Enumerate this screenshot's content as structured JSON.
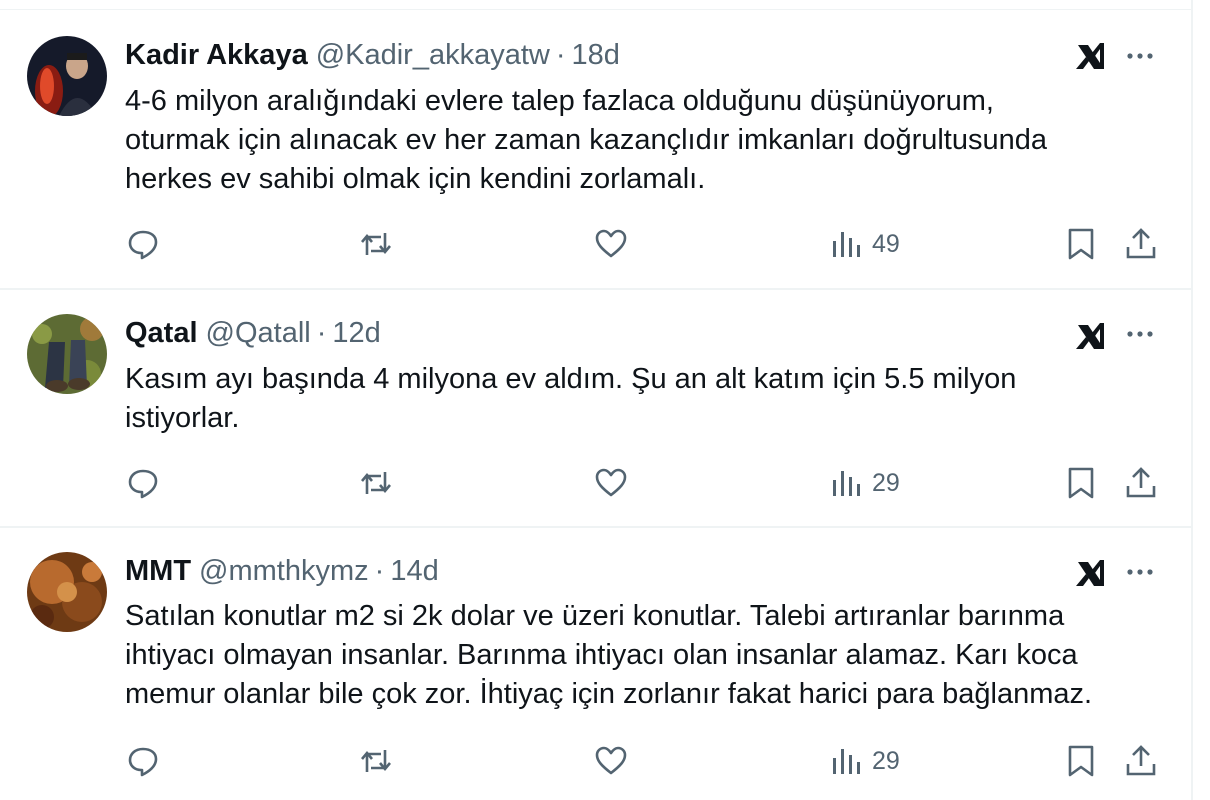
{
  "tweets": [
    {
      "name": "Kadir Akkaya",
      "handle": "@Kadir_akkayatw",
      "separator": "·",
      "time": "18d",
      "text": "4-6 milyon aralığındaki evlere talep fazlaca olduğunu düşünüyorum,\noturmak için alınacak ev her zaman kazançlıdır imkanları doğrultusunda\nherkes ev sahibi olmak için kendini zorlamalı.",
      "views": "49",
      "avatar_colors": [
        "#1a1a2e",
        "#c0392b"
      ]
    },
    {
      "name": "Qatal",
      "handle": "@Qatall",
      "separator": "·",
      "time": "12d",
      "text": "Kasım ayı başında 4 milyona ev aldım. Şu an alt katım için 5.5 milyon\nistiyorlar.",
      "views": "29",
      "avatar_colors": [
        "#6b7a3a",
        "#3d4a5c"
      ]
    },
    {
      "name": "MMT",
      "handle": "@mmthkymz",
      "separator": "·",
      "time": "14d",
      "text": "Satılan konutlar m2 si 2k dolar ve üzeri konutlar. Talebi artıranlar barınma\nihtiyacı olmayan insanlar. Barınma ihtiyacı olan insanlar alamaz. Karı koca\nmemur olanlar bile çok zor. İhtiyaç için zorlanır fakat harici para bağlanmaz.",
      "views": "29",
      "avatar_colors": [
        "#8a4a1c",
        "#c97a3a"
      ]
    }
  ],
  "icons": {
    "reply": "reply-icon",
    "repost": "repost-icon",
    "like": "like-icon",
    "views": "views-icon",
    "bookmark": "bookmark-icon",
    "share": "share-icon",
    "grok": "grok-icon",
    "more": "more-icon"
  },
  "colors": {
    "text": "#0f1419",
    "secondary": "#536471",
    "border": "#eff3f4"
  }
}
